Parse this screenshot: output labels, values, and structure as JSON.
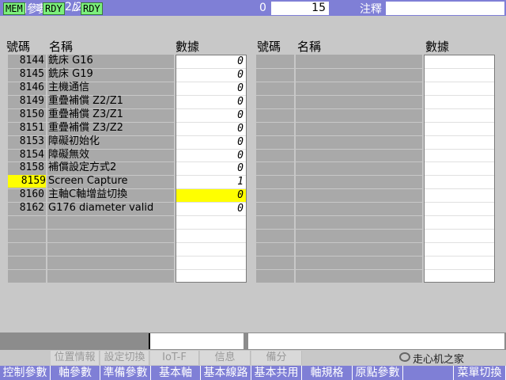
{
  "title": {
    "text": "控制參數",
    "page": "2/2",
    "zero": "0",
    "count": "15",
    "note_label": "注釋"
  },
  "headers": {
    "no": "號碼",
    "name": "名稱",
    "data": "數據"
  },
  "rows": [
    {
      "no": "8144",
      "name": "銑床 G16",
      "value": "0"
    },
    {
      "no": "8145",
      "name": "銑床 G19",
      "value": "0"
    },
    {
      "no": "8146",
      "name": "主機通信",
      "value": "0"
    },
    {
      "no": "8149",
      "name": "重疊補償 Z2/Z1",
      "value": "0"
    },
    {
      "no": "8150",
      "name": "重疊補償 Z3/Z1",
      "value": "0"
    },
    {
      "no": "8151",
      "name": "重疊補償 Z3/Z2",
      "value": "0"
    },
    {
      "no": "8153",
      "name": "障礙初始化",
      "value": "0"
    },
    {
      "no": "8154",
      "name": "障礙無效",
      "value": "0"
    },
    {
      "no": "8158",
      "name": "補償設定方式2",
      "value": "0"
    },
    {
      "no": "8159",
      "name": "Screen Capture",
      "value": "1"
    },
    {
      "no": "8160",
      "name": "主軸C軸增益切換",
      "value": "0"
    },
    {
      "no": "8162",
      "name": "G176 diameter valid",
      "value": "0"
    }
  ],
  "status": {
    "mode": "MEM",
    "sys1_num": "1",
    "sys1_state": "RDY",
    "sys2_num": "2",
    "sys2_state": "RDY"
  },
  "softkeys_top": [
    "位置情報",
    "設定切換",
    "IoT-F",
    "信息",
    "備分"
  ],
  "softkeys": [
    "控制參數",
    "軸參數",
    "準備參數",
    "基本軸",
    "基本線路",
    "基本共用",
    "軸規格",
    "原點參數",
    "",
    "菜單切換"
  ],
  "watermark": "走心机之家",
  "colors": {
    "title_bg": "#7f7fd6",
    "highlight": "#ffff00",
    "status_green": "#7cf07c"
  }
}
